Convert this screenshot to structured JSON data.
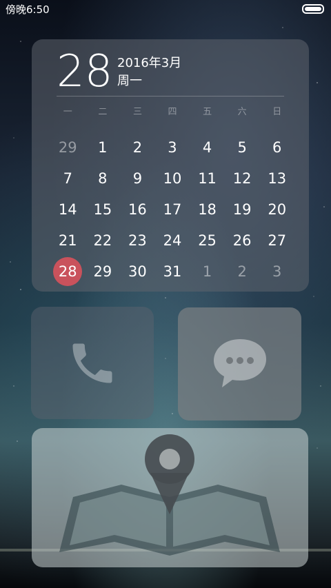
{
  "status_bar": {
    "time": "傍晚6:50",
    "battery_icon": "battery-icon"
  },
  "calendar_widget": {
    "day": "28",
    "year_month": "2016年3月",
    "weekday": "周一",
    "weekday_headers": [
      "一",
      "二",
      "三",
      "四",
      "五",
      "六",
      "日"
    ],
    "days": [
      "29",
      "1",
      "2",
      "3",
      "4",
      "5",
      "6",
      "7",
      "8",
      "9",
      "10",
      "11",
      "12",
      "13",
      "14",
      "15",
      "16",
      "17",
      "18",
      "19",
      "20",
      "21",
      "22",
      "23",
      "24",
      "25",
      "26",
      "27",
      "28",
      "29",
      "30",
      "31",
      "1",
      "2",
      "3"
    ],
    "dim_indices": [
      0,
      32,
      33,
      34
    ],
    "today_index": 28,
    "today_color": "#c9525c"
  },
  "apps": {
    "phone_icon": "phone-icon",
    "messages_icon": "chat-bubble-icon",
    "maps_icon": "map-pin-icon"
  }
}
